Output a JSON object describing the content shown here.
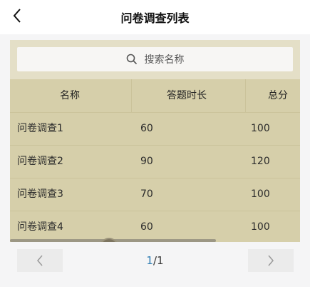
{
  "header": {
    "title": "问卷调查列表"
  },
  "search": {
    "placeholder": "搜索名称"
  },
  "table": {
    "columns": [
      "名称",
      "答题时长",
      "总分"
    ],
    "rows": [
      {
        "name": "问卷调查1",
        "duration": "60",
        "score": "100"
      },
      {
        "name": "问卷调查2",
        "duration": "90",
        "score": "120"
      },
      {
        "name": "问卷调查3",
        "duration": "70",
        "score": "100"
      },
      {
        "name": "问卷调查4",
        "duration": "60",
        "score": "100"
      }
    ],
    "horizontal_scroll_fraction": 0.71
  },
  "pagination": {
    "current": "1",
    "separator": "/",
    "total": "1"
  },
  "icons": {
    "back": "chevron-left-icon",
    "search": "search-icon",
    "prev": "chevron-left-icon",
    "next": "chevron-right-icon"
  },
  "colors": {
    "table_bg": "#d6cfaa",
    "search_area_bg": "#e4dfc7",
    "page_current": "#2a7ab0"
  }
}
